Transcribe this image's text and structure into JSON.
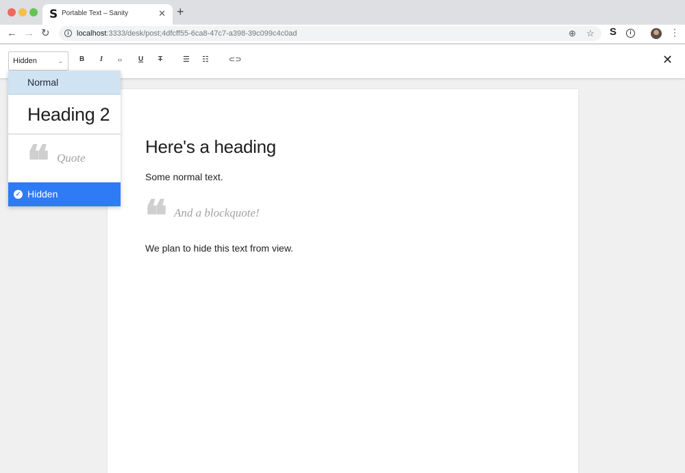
{
  "browser": {
    "tab_title": "Portable Text – Sanity",
    "tab_favicon": "S",
    "tab_close": "✕",
    "new_tab": "+",
    "url_host": "localhost",
    "url_path": ":3333/desk/post;4dfcff55-6ca8-47c7-a398-39c099c4c0ad",
    "extension_letter": "S"
  },
  "editor": {
    "style_select": {
      "value": "Hidden"
    },
    "toolbar": {
      "bold": "B",
      "italic": "I",
      "code": "‹›",
      "underline": "U",
      "strike": "T"
    },
    "dropdown": {
      "options": [
        {
          "label": "Normal"
        },
        {
          "label": "Heading 2"
        },
        {
          "label": "Quote"
        },
        {
          "label": "Hidden",
          "selected": true
        }
      ]
    }
  },
  "document": {
    "heading": "Here's a heading",
    "paragraph": "Some normal text.",
    "blockquote": "And a blockquote!",
    "hidden_text": "We plan to hide this text from view."
  },
  "colors": {
    "selected_option_bg": "#2f7bf6",
    "hover_option_bg": "#cfe3f3",
    "quote_mark": "#cfcfcf"
  },
  "icons": {
    "back": "arrow-left-icon",
    "forward": "arrow-right-icon",
    "reload": "reload-icon",
    "info": "info-icon",
    "zoom": "zoom-icon",
    "bookmark": "star-icon",
    "menu": "menu-dots-icon",
    "close": "close-icon",
    "check": "check-circle-icon",
    "chevron": "chevron-down-icon"
  }
}
